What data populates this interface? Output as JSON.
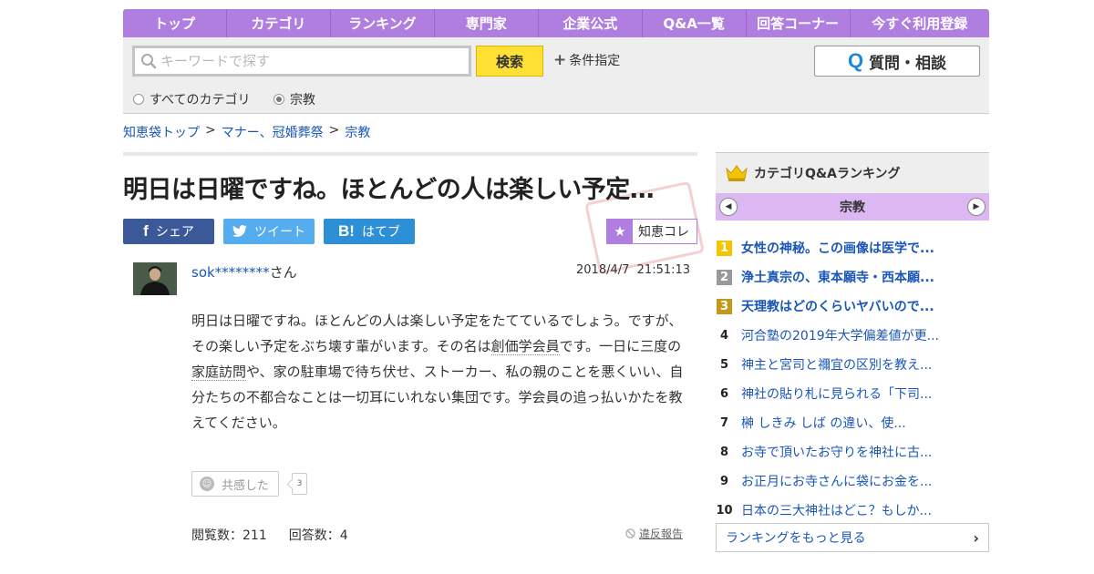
{
  "nav": {
    "items": [
      "トップ",
      "カテゴリ",
      "ランキング",
      "専門家",
      "企業公式",
      "Q&A一覧",
      "回答コーナー",
      "今すぐ利用登録"
    ]
  },
  "search": {
    "placeholder": "キーワードで探す",
    "value": "",
    "button_label": "検索",
    "condition_label": "条件指定",
    "radio_all": "すべてのカテゴリ",
    "radio_current": "宗教",
    "selected": "宗教"
  },
  "ask_button": {
    "q": "Q",
    "label": "質問・相談"
  },
  "breadcrumb": {
    "items": [
      "知恵袋トップ",
      "マナー、冠婚葬祭",
      "宗教"
    ],
    "separator": ">"
  },
  "question": {
    "title": "明日は日曜ですね。ほとんどの人は楽しい予定…",
    "user_id": "sok********",
    "user_suffix": "さん",
    "date": "2018/4/7",
    "time": "21:51:13",
    "body_parts": [
      "明日は日曜ですね。ほとんどの人は楽しい予定をたてているでしょう。ですが、その楽しい予定をぶち壊す輩がいます。その名は",
      "創価学会員",
      "です。一日に三度の",
      "家庭訪問",
      "や、家の駐車場で待ち伏せ、ストーカー、私の親のことを悪くいい、自分たちの不都合なことは一切耳にいれない集団です。学会員の追っ払いかたを教えてください。"
    ],
    "empathy_label": "共感した",
    "empathy_count": "3",
    "views_label": "閲覧数：211",
    "answers_label": "回答数：4",
    "report_label": "違反報告"
  },
  "share": {
    "facebook": "シェア",
    "twitter": "ツイート",
    "hatena": "はてブ",
    "chiecore": "知恵コレ"
  },
  "ranking": {
    "header": "カテゴリQ&Aランキング",
    "category": "宗教",
    "items": [
      {
        "rank": "1",
        "text": "女性の神秘。この画像は医学で..."
      },
      {
        "rank": "2",
        "text": "浄土真宗の、東本願寺・西本願..."
      },
      {
        "rank": "3",
        "text": "天理教はどのくらいヤバいので..."
      },
      {
        "rank": "4",
        "text": "河合塾の2019年大学偏差値が更..."
      },
      {
        "rank": "5",
        "text": "神主と宮司と禰宜の区別を教え..."
      },
      {
        "rank": "6",
        "text": "神社の貼り札に見られる「下司..."
      },
      {
        "rank": "7",
        "text": "榊 しきみ しば の違い、使..."
      },
      {
        "rank": "8",
        "text": "お寺で頂いたお守りを神社に古..."
      },
      {
        "rank": "9",
        "text": "お正月にお寺さんに袋にお金を..."
      },
      {
        "rank": "10",
        "text": "日本の三大神社はどこ？もしか..."
      }
    ],
    "more_label": "ランキングをもっと見る"
  },
  "colors": {
    "nav_bg": "#b07ee0",
    "search_button": "#ffe033",
    "link": "#1a56b8",
    "facebook": "#3b5998",
    "twitter": "#55acee",
    "hatena": "#2d8fd5",
    "ranking_category_bg": "#dcb8f2"
  }
}
